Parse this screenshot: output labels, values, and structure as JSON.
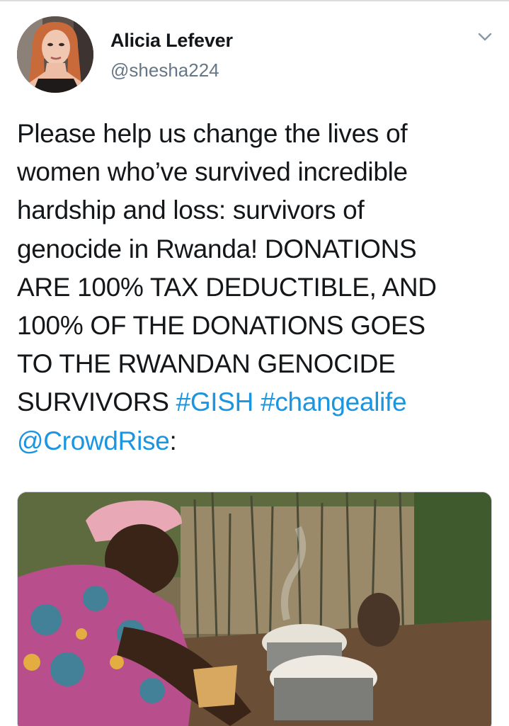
{
  "tweet": {
    "author": {
      "display_name": "Alicia Lefever",
      "handle": "@shesha224"
    },
    "text_lines": [
      {
        "text": "Please help us change the lives of"
      },
      {
        "text": "women who’ve survived incredible"
      },
      {
        "text": "hardship and loss: survivors of"
      },
      {
        "text": "genocide in Rwanda! DONATIONS"
      },
      {
        "text": "ARE 100% TAX DEDUCTIBLE, AND"
      },
      {
        "text": "100% OF THE DONATIONS GOES"
      },
      {
        "text": "TO THE RWANDAN GENOCIDE"
      }
    ],
    "line8": {
      "prefix": "SURVIVORS ",
      "hashtag1": "#GISH",
      "space": " ",
      "hashtag2": "#changealife"
    },
    "line9": {
      "mention": "@CrowdRise",
      "suffix": ":"
    },
    "colors": {
      "link": "#1b95e0",
      "text": "#14171a",
      "secondary": "#657786"
    },
    "icons": {
      "more": "chevron-down-icon"
    }
  }
}
